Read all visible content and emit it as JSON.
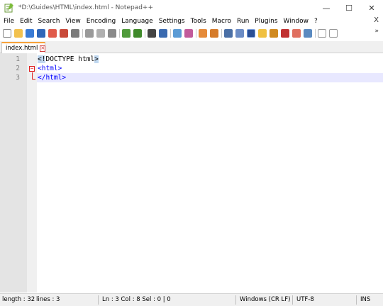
{
  "window": {
    "title": "*D:\\Guides\\HTML\\index.html - Notepad++",
    "minimize": "—",
    "maximize": "☐",
    "close": "✕"
  },
  "menu": {
    "items": [
      "File",
      "Edit",
      "Search",
      "View",
      "Encoding",
      "Language",
      "Settings",
      "Tools",
      "Macro",
      "Run",
      "Plugins",
      "Window",
      "?"
    ],
    "close": "X"
  },
  "toolbar": {
    "more": "»",
    "icons": [
      "new-file",
      "open-file",
      "save",
      "save-all",
      "close",
      "close-all",
      "print",
      "cut",
      "copy",
      "paste",
      "undo",
      "redo",
      "find",
      "replace",
      "zoom-in",
      "zoom-out",
      "sync-v",
      "sync-h",
      "word-wrap",
      "show-all-chars",
      "indent-guide",
      "user-lang",
      "doc-map",
      "function-list",
      "folder-workspace",
      "monitoring",
      "record-macro",
      "stop-macro"
    ]
  },
  "tab": {
    "label": "index.html",
    "close": "✕"
  },
  "editor": {
    "lines": [
      {
        "no": "1",
        "open": "<",
        "bang": "!",
        "doctype": "DOCTYPE html",
        "close": ">"
      },
      {
        "no": "2",
        "text": "<html>"
      },
      {
        "no": "3",
        "text": "</html>"
      }
    ],
    "fold_marker": "−"
  },
  "status": {
    "length": "length : 32",
    "lines": "lines : 3",
    "position": "Ln : 3    Col : 8    Sel : 0 | 0",
    "eol": "Windows (CR LF)",
    "encoding": "UTF-8",
    "mode": "INS"
  },
  "colors": {
    "tag": "#0000ff",
    "current_line": "#e8e8ff",
    "fold_marker": "#e02020",
    "tab_accent": "#f7a23a"
  }
}
